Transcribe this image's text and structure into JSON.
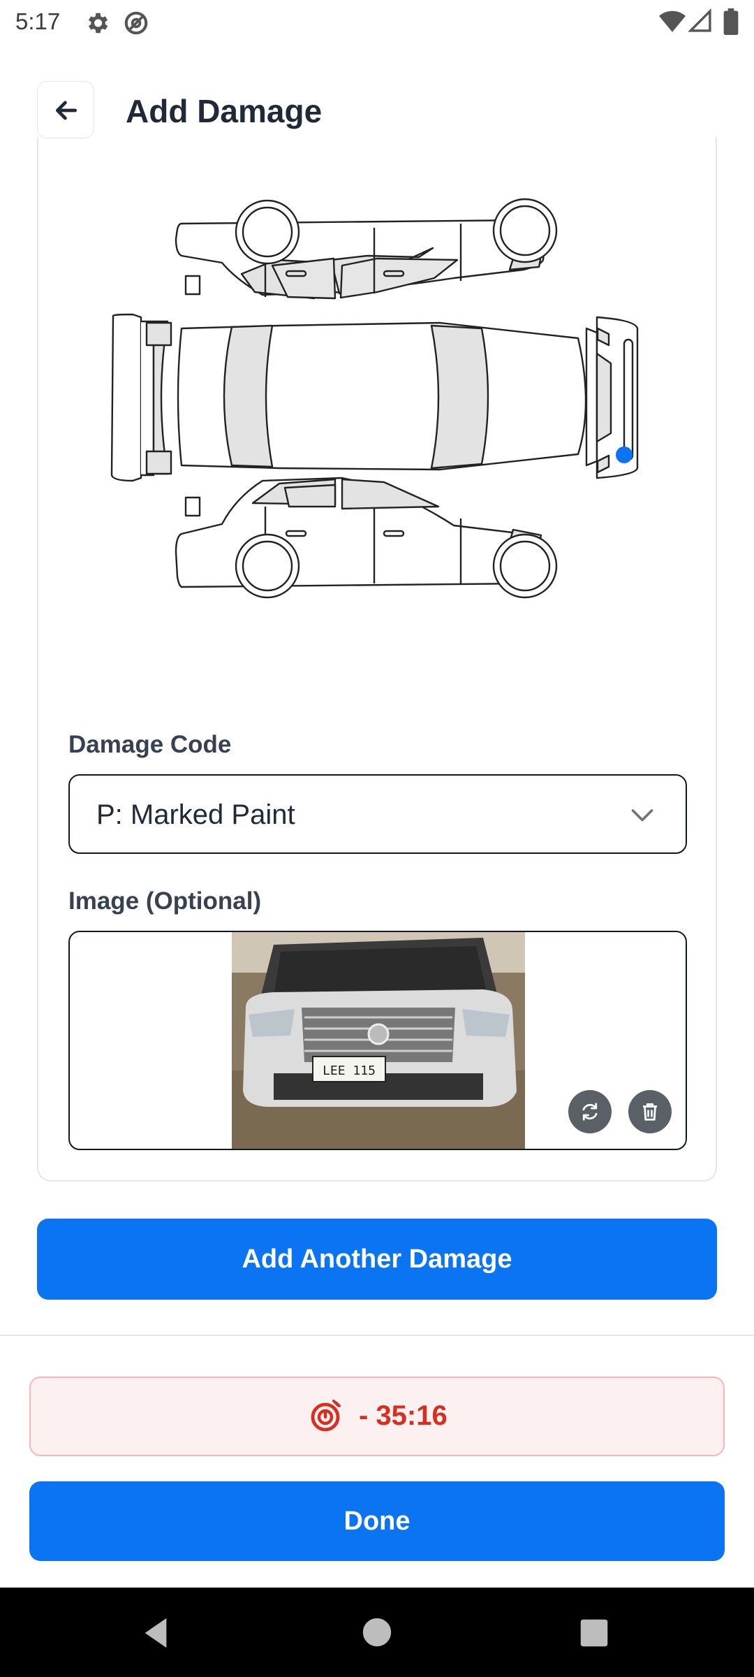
{
  "status": {
    "time": "5:17"
  },
  "header": {
    "title": "Add Damage"
  },
  "form": {
    "damage_code_label": "Damage Code",
    "damage_code_value": "P: Marked Paint",
    "image_label": "Image (Optional)",
    "photo_plate": "LEE 115"
  },
  "actions": {
    "add_another": "Add Another Damage",
    "done": "Done"
  },
  "timer": {
    "value": "- 35:16"
  },
  "colors": {
    "accent": "#0a74f2",
    "timer": "#d92d20",
    "marker": "#0a74f2"
  }
}
